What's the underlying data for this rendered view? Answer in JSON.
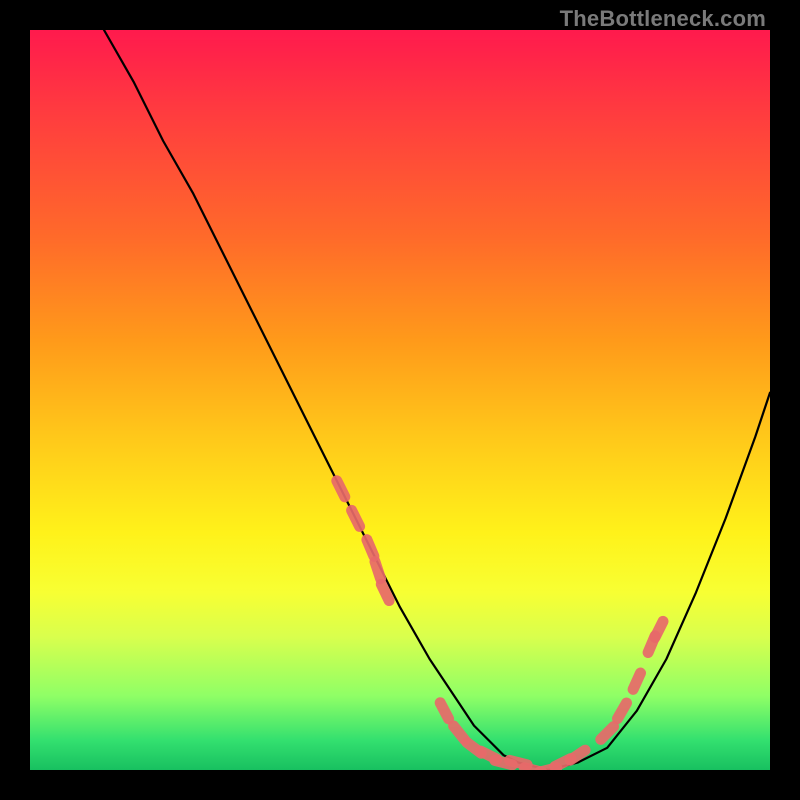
{
  "watermark": "TheBottleneck.com",
  "gradient_colors": {
    "top": "#ff1a4d",
    "upper_mid": "#ff9a1a",
    "mid": "#fff21a",
    "lower_mid": "#d9ff4d",
    "bottom": "#18c060"
  },
  "chart_data": {
    "type": "line",
    "title": "",
    "xlabel": "",
    "ylabel": "",
    "xlim": [
      0,
      100
    ],
    "ylim": [
      0,
      100
    ],
    "grid": false,
    "legend": false,
    "series": [
      {
        "name": "bottleneck-curve",
        "color": "#000000",
        "x": [
          10,
          14,
          18,
          22,
          26,
          30,
          34,
          38,
          42,
          46,
          50,
          54,
          58,
          60,
          62,
          64,
          66,
          70,
          74,
          78,
          82,
          86,
          90,
          94,
          98,
          100
        ],
        "y": [
          100,
          93,
          85,
          78,
          70,
          62,
          54,
          46,
          38,
          30,
          22,
          15,
          9,
          6,
          4,
          2,
          1,
          0,
          1,
          3,
          8,
          15,
          24,
          34,
          45,
          51
        ]
      }
    ],
    "markers": [
      {
        "name": "highlight-dots",
        "color": "#e86a6a",
        "shape": "capsule",
        "points": [
          {
            "x": 42,
            "y": 38
          },
          {
            "x": 44,
            "y": 34
          },
          {
            "x": 46,
            "y": 30
          },
          {
            "x": 47,
            "y": 27
          },
          {
            "x": 48,
            "y": 24
          },
          {
            "x": 56,
            "y": 8
          },
          {
            "x": 58,
            "y": 5
          },
          {
            "x": 60,
            "y": 3
          },
          {
            "x": 62,
            "y": 2
          },
          {
            "x": 64,
            "y": 1
          },
          {
            "x": 66,
            "y": 1
          },
          {
            "x": 68,
            "y": 0
          },
          {
            "x": 70,
            "y": 0
          },
          {
            "x": 72,
            "y": 1
          },
          {
            "x": 74,
            "y": 2
          },
          {
            "x": 78,
            "y": 5
          },
          {
            "x": 80,
            "y": 8
          },
          {
            "x": 82,
            "y": 12
          },
          {
            "x": 84,
            "y": 17
          },
          {
            "x": 85,
            "y": 19
          }
        ]
      }
    ]
  }
}
